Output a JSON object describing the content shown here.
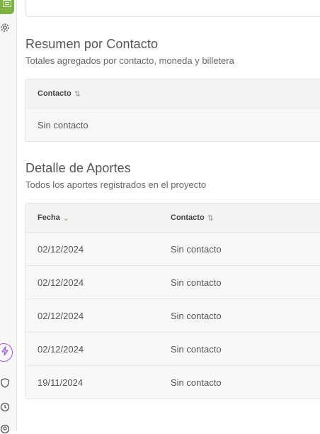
{
  "sidebar": {
    "icons": [
      "list-icon",
      "gear-icon",
      "lightning-icon",
      "shield-icon",
      "history-icon",
      "user-icon"
    ]
  },
  "summary": {
    "title": "Resumen por Contacto",
    "subtitle": "Totales agregados por contacto, moneda y billetera",
    "columns": [
      {
        "label": "Contacto",
        "sort": "⇅"
      }
    ],
    "rows": [
      [
        "Sin contacto"
      ]
    ]
  },
  "detail": {
    "title": "Detalle de Aportes",
    "subtitle": "Todos los aportes registrados en el proyecto",
    "columns": [
      {
        "label": "Fecha",
        "sort": "⌄"
      },
      {
        "label": "Contacto",
        "sort": "⇅"
      }
    ],
    "rows": [
      [
        "02/12/2024",
        "Sin contacto"
      ],
      [
        "02/12/2024",
        "Sin contacto"
      ],
      [
        "02/12/2024",
        "Sin contacto"
      ],
      [
        "02/12/2024",
        "Sin contacto"
      ],
      [
        "19/11/2024",
        "Sin contacto"
      ]
    ]
  },
  "colors": {
    "accent_green": "#7cb342",
    "accent_purple": "#9c5ae0"
  }
}
